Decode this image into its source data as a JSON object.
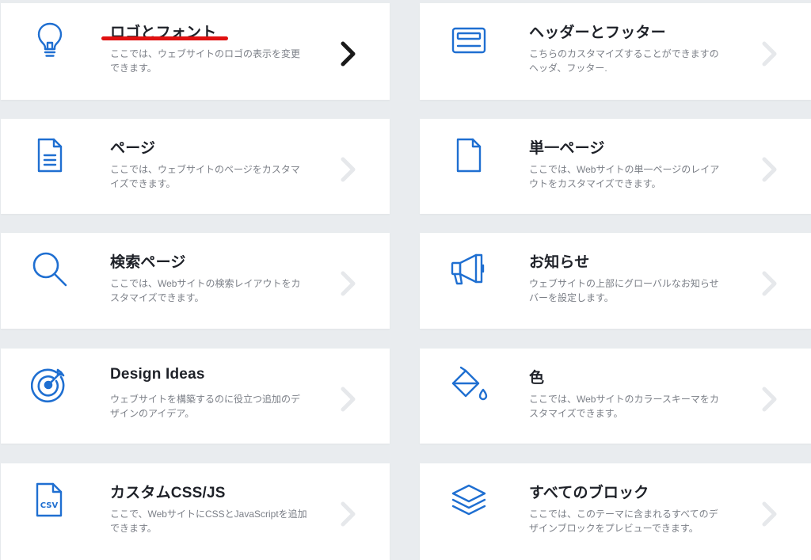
{
  "colors": {
    "icon": "#1f6fd1",
    "chevron": "#e6e8eb",
    "chevron_active": "#1a1a1a",
    "highlight": "#e01010"
  },
  "cards": [
    {
      "title": "ロゴとフォント",
      "desc": "ここでは、ウェブサイトのロゴの表示を変更できます。",
      "icon": "lightbulb-icon"
    },
    {
      "title": "ヘッダーとフッター",
      "desc": "こちらのカスタマイズすることができますのヘッダ、フッター.",
      "icon": "header-footer-icon"
    },
    {
      "title": "ページ",
      "desc": "ここでは、ウェブサイトのページをカスタマイズできます。",
      "icon": "document-icon"
    },
    {
      "title": "単一ページ",
      "desc": "ここでは、Webサイトの単一ページのレイアウトをカスタマイズできます。",
      "icon": "blank-page-icon"
    },
    {
      "title": "検索ページ",
      "desc": "ここでは、Webサイトの検索レイアウトをカスタマイズできます。",
      "icon": "search-icon"
    },
    {
      "title": "お知らせ",
      "desc": "ウェブサイトの上部にグローバルなお知らせバーを設定します。",
      "icon": "megaphone-icon"
    },
    {
      "title": "Design Ideas",
      "desc": "ウェブサイトを構築するのに役立つ追加のデザインのアイデア。",
      "icon": "target-icon"
    },
    {
      "title": "色",
      "desc": "ここでは、Webサイトのカラースキーマをカスタマイズできます。",
      "icon": "paint-bucket-icon"
    },
    {
      "title": "カスタムCSS/JS",
      "desc": "ここで、WebサイトにCSSとJavaScriptを追加できます。",
      "icon": "csv-file-icon"
    },
    {
      "title": "すべてのブロック",
      "desc": "ここでは、このテーマに含まれるすべてのデザインブロックをプレビューできます。",
      "icon": "layers-icon"
    }
  ]
}
